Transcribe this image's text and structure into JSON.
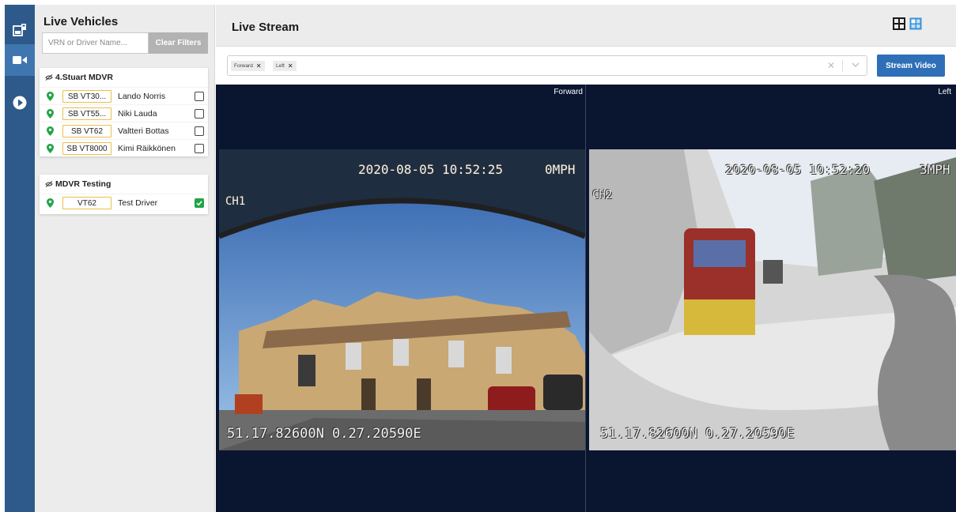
{
  "rail": {
    "items": [
      {
        "icon": "vehicles-map-icon",
        "active": false
      },
      {
        "icon": "video-camera-icon",
        "active": true
      },
      {
        "icon": "play-circle-icon",
        "active": false
      }
    ]
  },
  "vehicles_panel": {
    "title": "Live Vehicles",
    "search_placeholder": "VRN or Driver Name...",
    "clear_label": "Clear Filters",
    "groups": [
      {
        "name": "4.Stuart MDVR",
        "vehicles": [
          {
            "vrn": "SB VT30...",
            "driver": "Lando Norris",
            "checked": false
          },
          {
            "vrn": "SB VT55...",
            "driver": "Niki Lauda",
            "checked": false
          },
          {
            "vrn": "SB VT62",
            "driver": "Valtteri Bottas",
            "checked": false
          },
          {
            "vrn": "SB VT8000",
            "driver": "Kimi Räikkönen",
            "checked": false
          }
        ]
      },
      {
        "name": "MDVR Testing",
        "vehicles": [
          {
            "vrn": "VT62",
            "driver": "Test Driver",
            "checked": true
          }
        ]
      }
    ]
  },
  "main": {
    "title": "Live Stream",
    "layout_icons": [
      "grid-2x2-icon",
      "grid-layout-icon"
    ],
    "selected_cameras": [
      "Forward",
      "Left"
    ],
    "stream_button": "Stream Video"
  },
  "cameras": [
    {
      "label": "Forward",
      "channel": "CH1",
      "datetime": "2020-08-05 10:52:25",
      "speed": "0MPH",
      "gps": "51.17.82600N 0.27.20590E"
    },
    {
      "label": "Left",
      "channel": "CH2",
      "datetime": "2020-08-05 10:52:20",
      "speed": "3MPH",
      "gps": "51.17.82600N 0.27.20590E"
    }
  ],
  "colors": {
    "rail": "#2d5a8a",
    "accent": "#2e6fb8",
    "panel_bg": "#ececec",
    "vrn_border": "#e8c14a",
    "pin_green": "#22a447",
    "video_bg": "#0a1530"
  }
}
